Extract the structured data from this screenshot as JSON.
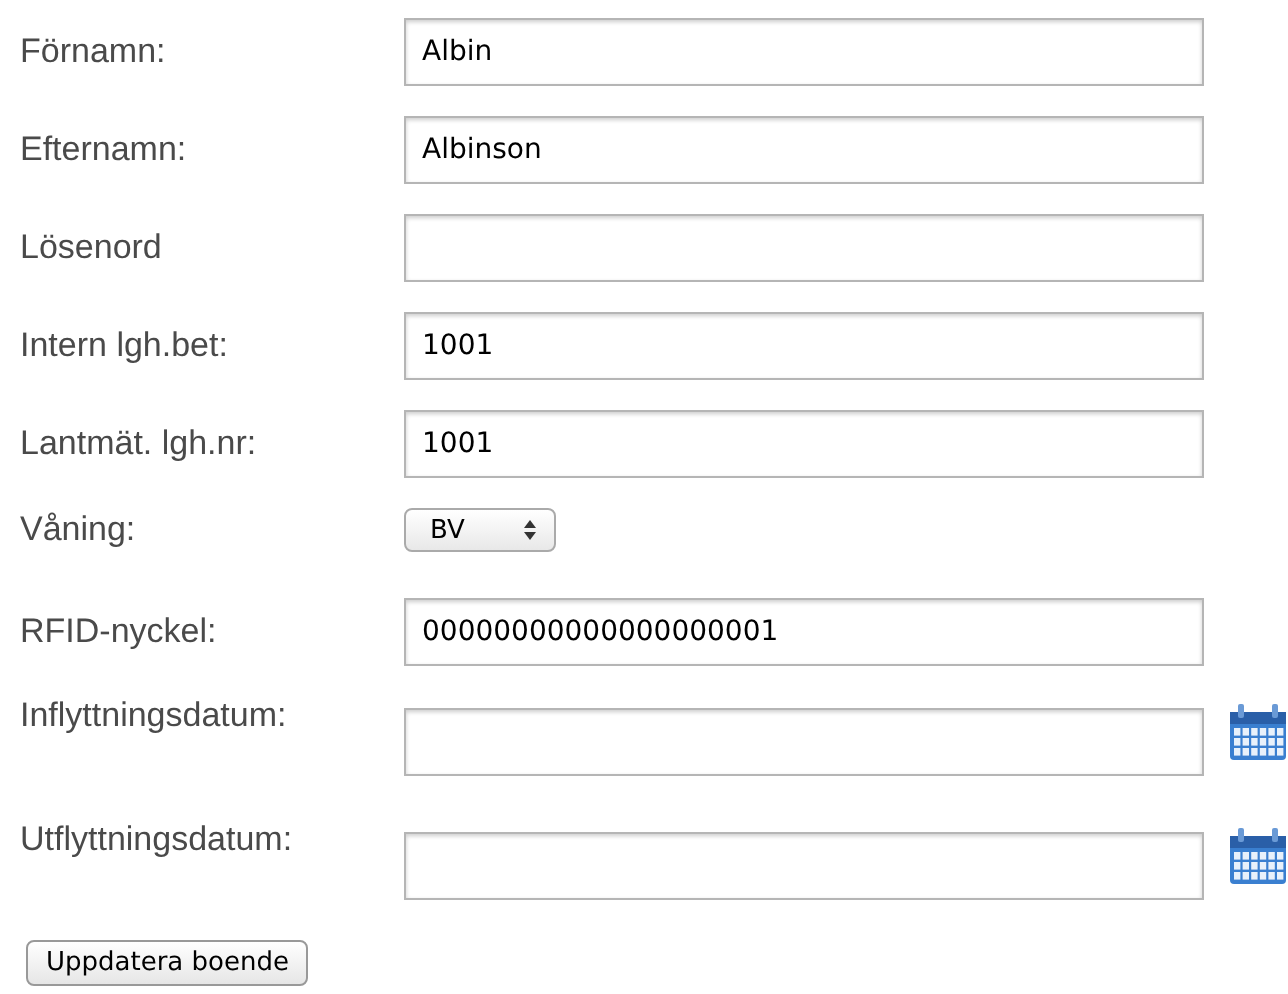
{
  "fields": [
    {
      "kind": "text",
      "label": "Förnamn:",
      "value": "Albin"
    },
    {
      "kind": "text",
      "label": "Efternamn:",
      "value": "Albinson"
    },
    {
      "kind": "text",
      "label": "Lösenord"
    },
    {
      "kind": "text",
      "label": "Intern lgh.bet:",
      "value": "1001"
    },
    {
      "kind": "text",
      "label": "Lantmät. lgh.nr:",
      "value": "1001"
    },
    {
      "kind": "select",
      "label": "Våning:",
      "value": "BV"
    },
    {
      "kind": "text",
      "label": "RFID-nyckel:",
      "value": "00000000000000000001"
    },
    {
      "kind": "date",
      "label": "Inflyttningsdatum:"
    },
    {
      "kind": "date",
      "label": "Utflyttningsdatum:"
    }
  ],
  "submit_button": "Uppdatera boende"
}
